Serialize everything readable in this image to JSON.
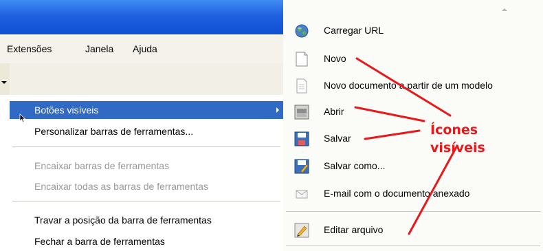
{
  "menubar": {
    "items": [
      "Extensões",
      "Janela",
      "Ajuda"
    ]
  },
  "context_menu": {
    "items": [
      {
        "label": "Botões visíveis",
        "state": "highlighted",
        "has_submenu": true
      },
      {
        "label": "Personalizar barras de ferramentas...",
        "state": "normal"
      },
      {
        "label": "Encaixar barras de ferramentas",
        "state": "disabled"
      },
      {
        "label": "Encaixar todas as barras de ferramentas",
        "state": "disabled"
      },
      {
        "label": "Travar a posição da barra de ferramentas",
        "state": "normal"
      },
      {
        "label": "Fechar a barra de ferramentas",
        "state": "normal"
      }
    ]
  },
  "submenu": {
    "items": [
      {
        "label": "Carregar URL",
        "icon": "globe-icon"
      },
      {
        "label": "Novo",
        "icon": "new-document-icon"
      },
      {
        "label": "Novo documento a partir de um modelo",
        "icon": "template-document-icon"
      },
      {
        "label": "Abrir",
        "icon": "open-folder-icon"
      },
      {
        "label": "Salvar",
        "icon": "floppy-disk-icon"
      },
      {
        "label": "Salvar como...",
        "icon": "save-as-icon"
      },
      {
        "label": "E-mail com o documento anexado",
        "icon": "email-icon"
      },
      {
        "label": "Editar arquivo",
        "icon": "edit-file-icon"
      }
    ]
  },
  "annotation": {
    "line1": "Ícones",
    "line2": "visíveis",
    "color": "#e8181b"
  },
  "colors": {
    "titlebar": "#1f61e0",
    "highlight": "#316ac5"
  }
}
